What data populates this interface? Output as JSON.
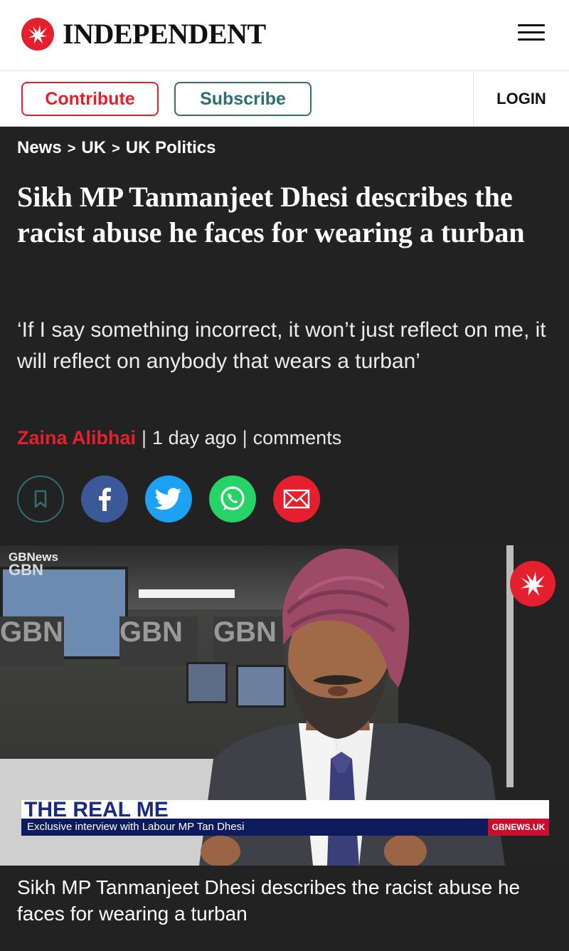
{
  "header": {
    "brand": "INDEPENDENT",
    "logo_icon": "eagle-icon",
    "menu_icon": "hamburger-menu-icon"
  },
  "actions": {
    "contribute": "Contribute",
    "subscribe": "Subscribe",
    "login": "LOGIN"
  },
  "breadcrumb": [
    "News",
    "UK",
    "UK Politics"
  ],
  "breadcrumb_separator": ">",
  "article": {
    "headline": "Sikh MP Tanmanjeet Dhesi describes the racist abuse he faces for wearing a turban",
    "standfirst": "‘If I say something incorrect, it won’t just reflect on me, it will reflect on anybody that wears a turban’",
    "author": "Zaina Alibhai",
    "time": "1 day ago",
    "comments": "comments",
    "byline_separator": "|"
  },
  "share": [
    {
      "name": "bookmark-icon"
    },
    {
      "name": "facebook-icon"
    },
    {
      "name": "twitter-icon"
    },
    {
      "name": "whatsapp-icon"
    },
    {
      "name": "email-icon"
    }
  ],
  "video": {
    "channel_logo_top": "GBNews",
    "channel_logo_bottom": "GBN",
    "studio_sign": "GBN",
    "lower_third_title": "THE REAL ME",
    "lower_third_sub": "Exclusive interview with Labour MP Tan Dhesi",
    "lower_third_site": "GBNEWS.UK"
  },
  "caption": "Sikh MP Tanmanjeet Dhesi describes the racist abuse he faces for wearing a turban",
  "colors": {
    "brand_red": "#e4202e",
    "teal": "#2f6f74",
    "dark_bg": "#222222",
    "facebook": "#3b5998",
    "twitter": "#1da1f2",
    "whatsapp": "#25d366"
  }
}
